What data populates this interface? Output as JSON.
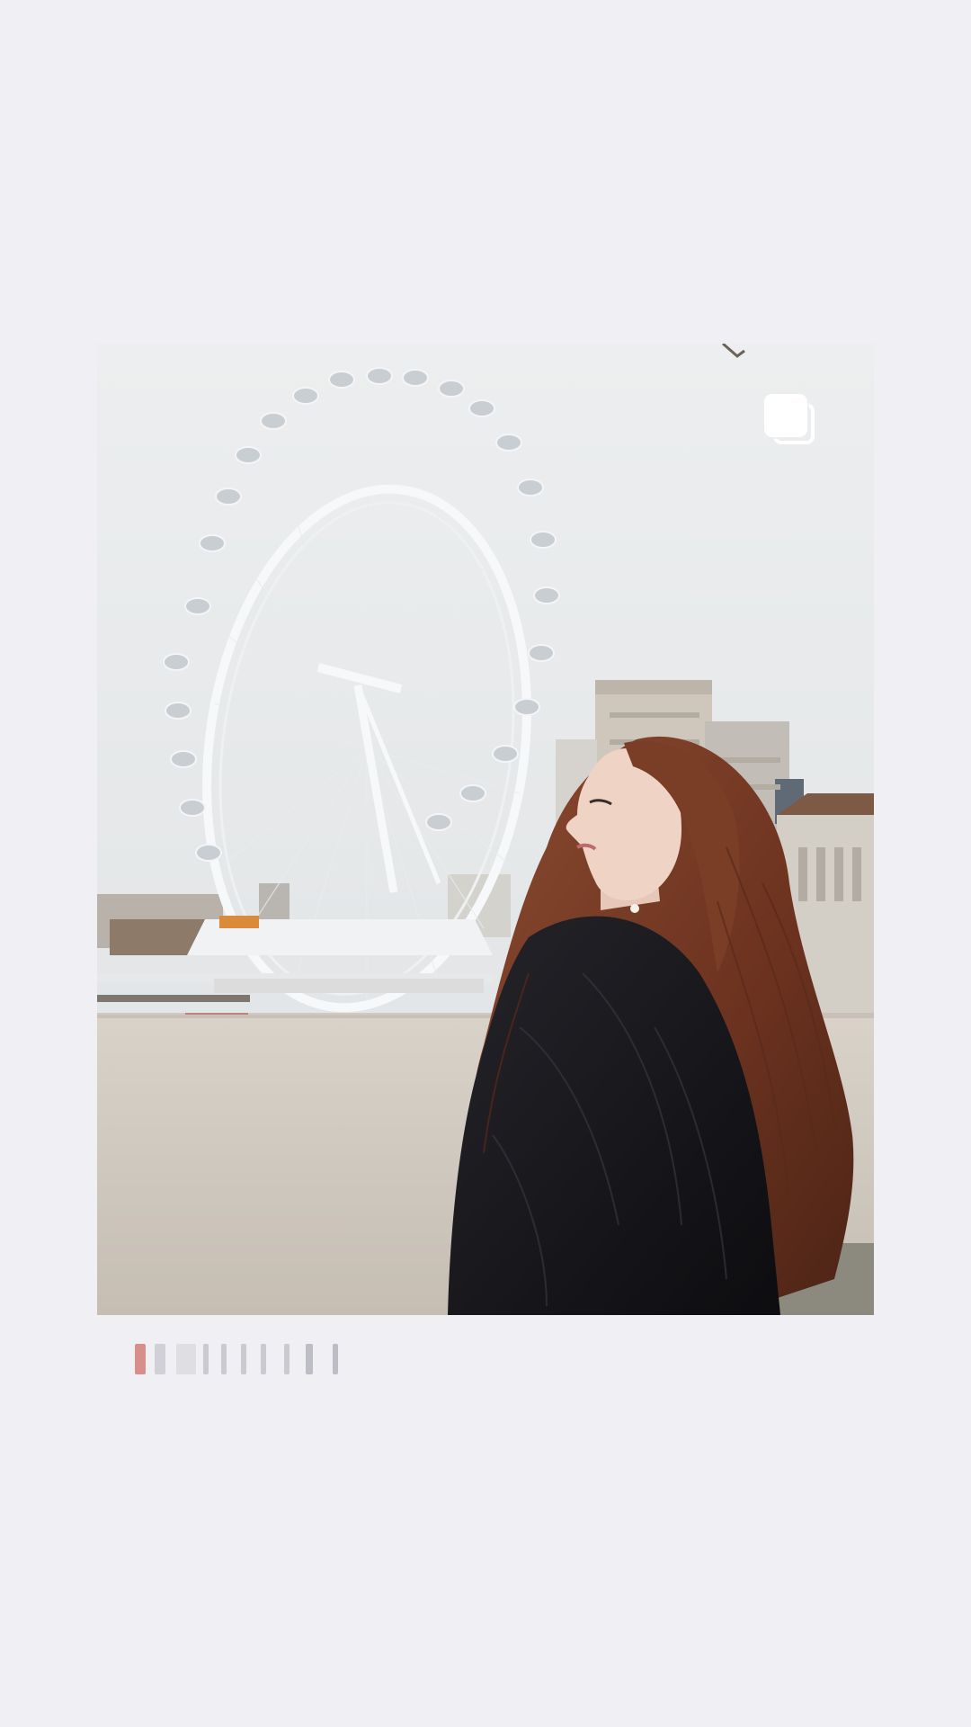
{
  "screen": {
    "background_color": "#efeff4"
  },
  "post": {
    "photo": {
      "alt": "",
      "scene": "woman-in-black-fur-coat-by-river-with-ferris-wheel"
    },
    "multi_photo_indicator": {
      "icon": "multiple-photos-icon"
    },
    "caption": {
      "text": "",
      "state": "blurred"
    }
  },
  "colors": {
    "sky": "#e6e8ea",
    "river": "#cdc6bc",
    "coat": "#141418",
    "hair": "#6e3522"
  }
}
